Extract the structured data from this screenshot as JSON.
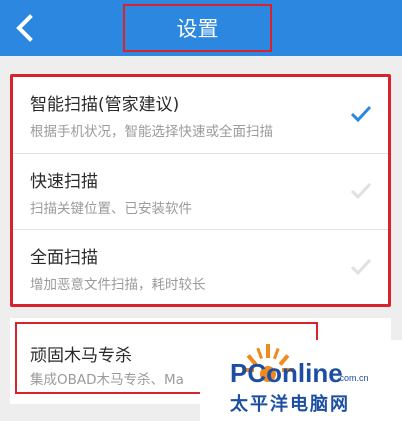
{
  "header": {
    "title": "设置",
    "back_icon": "chevron-left-icon",
    "bg_color": "#2b87e0"
  },
  "scan_options": [
    {
      "title": "智能扫描(管家建议)",
      "subtitle": "根据手机状况，智能选择快速或全面扫描",
      "selected": true
    },
    {
      "title": "快速扫描",
      "subtitle": "扫描关键位置、已安装软件",
      "selected": false
    },
    {
      "title": "全面扫描",
      "subtitle": "增加恶意文件扫描，耗时较长",
      "selected": false
    }
  ],
  "trojan": {
    "title": "顽固木马专杀",
    "subtitle": "集成OBAD木马专杀、Ma"
  },
  "watermark": {
    "brand": "PConline",
    "domain": ".com.cn",
    "cn_name": "太平洋电脑网"
  },
  "colors": {
    "highlight_border": "#d8232c",
    "check_active": "#2b87e0",
    "check_inactive": "#e0e0e0"
  }
}
